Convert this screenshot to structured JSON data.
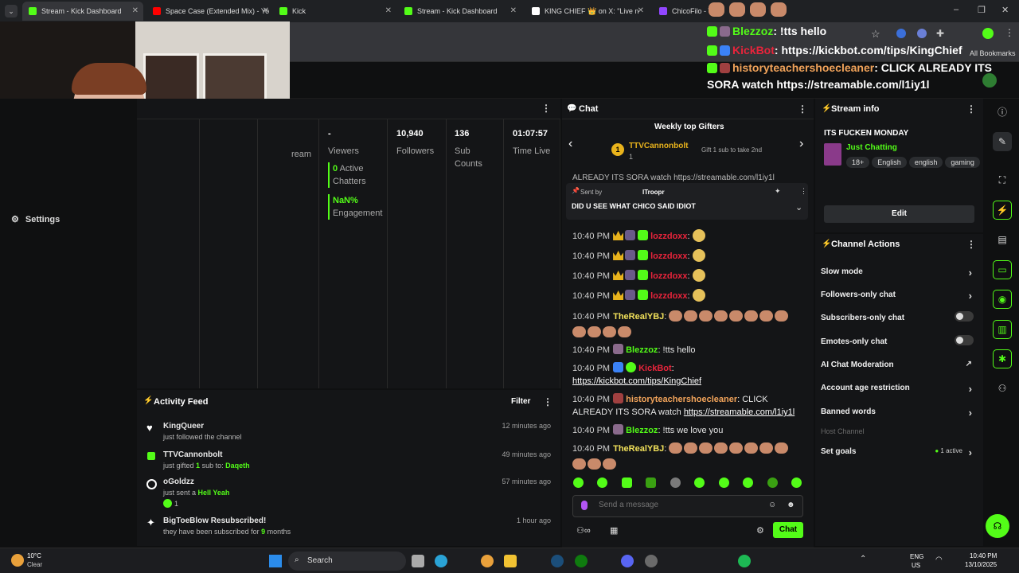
{
  "browser": {
    "tabs": [
      {
        "title": "Stream - Kick Dashboard",
        "color": "#53fc18"
      },
      {
        "title": "Space Case (Extended Mix) - Yo",
        "color": "#ff0000"
      },
      {
        "title": "Kick",
        "color": "#53fc18"
      },
      {
        "title": "Stream - Kick Dashboard",
        "color": "#53fc18"
      },
      {
        "title": "KING CHIEF 👑 on X: \"Live n",
        "color": "#ffffff"
      },
      {
        "title": "ChicoFilo - Twi",
        "color": "#9146ff"
      }
    ],
    "bookmarks_label": "All Bookmarks"
  },
  "overlay_chat": [
    {
      "user": "Blezzoz",
      "user_color": "#53fc18",
      "text": ": !tts hello"
    },
    {
      "user": "KickBot",
      "user_color": "#e8243b",
      "text": ": https://kickbot.com/tips/KingChief"
    },
    {
      "user": "historyteachershoecleaner",
      "user_color": "#f1a35a",
      "text": ": CLICK ALREADY ITS SORA watch https://streamable.com/l1iy1l"
    }
  ],
  "left_nav": {
    "settings_label": "Settings"
  },
  "stats": {
    "stream_label": "ream",
    "viewers_value": "-",
    "viewers_label": "Viewers",
    "active_chatters_value": "0",
    "active_chatters_label": "Active Chatters",
    "engagement_value": "NaN%",
    "engagement_label": "Engagement",
    "followers_value": "10,940",
    "followers_label": "Followers",
    "subs_value": "136",
    "subs_label": "Sub Counts",
    "time_live_value": "01:07:57",
    "time_live_label": "Time Live"
  },
  "activity": {
    "title": "Activity Feed",
    "filter_label": "Filter",
    "items": [
      {
        "name": "KingQueer",
        "sub": "just followed the channel",
        "time": "12 minutes ago"
      },
      {
        "name": "TTVCannonbolt",
        "sub_prefix": "just gifted",
        "sub_count": "1",
        "sub_mid": "sub to:",
        "sub_target": "Daqeth",
        "time": "49 minutes ago"
      },
      {
        "name": "oGoldzz",
        "sub_prefix": "just sent a",
        "sub_target": "Hell Yeah",
        "extra": "1",
        "time": "57 minutes ago"
      },
      {
        "name": "BigToeBlow Resubscribed!",
        "sub_prefix": "they have been subscribed for",
        "sub_count": "9",
        "sub_suffix": "months",
        "time": "1 hour ago"
      }
    ]
  },
  "chat": {
    "title": "Chat",
    "gifters_title": "Weekly top Gifters",
    "gifter_rank": "1",
    "gifter_name": "TTVCannonbolt",
    "gifter_count": "1",
    "gifter_hint": "Gift 1 sub to take 2nd",
    "scroll_preview": "ALREADY ITS SORA watch https://streamable.com/l1iy1l",
    "pinned_sent_by": "Sent by",
    "pinned_user": "ITroopr",
    "pinned_text": "DID U SEE WHAT CHICO SAID IDIOT",
    "messages": [
      {
        "time": "10:40 PM",
        "user": "lozzdoxx",
        "color": "#e8243b",
        "text": ":"
      },
      {
        "time": "10:40 PM",
        "user": "lozzdoxx",
        "color": "#e8243b",
        "text": ":"
      },
      {
        "time": "10:40 PM",
        "user": "lozzdoxx",
        "color": "#e8243b",
        "text": ":"
      },
      {
        "time": "10:40 PM",
        "user": "lozzdoxx",
        "color": "#e8243b",
        "text": ":"
      },
      {
        "time": "10:40 PM",
        "user": "TheRealYBJ",
        "color": "#f1e05a",
        "text": ":"
      },
      {
        "time": "10:40 PM",
        "user": "Blezzoz",
        "color": "#53fc18",
        "text": ": !tts hello"
      },
      {
        "time": "10:40 PM",
        "user": "KickBot",
        "color": "#e8243b",
        "text": ":",
        "link": "https://kickbot.com/tips/KingChief"
      },
      {
        "time": "10:40 PM",
        "user": "historyteachershoecleaner",
        "color": "#f1a35a",
        "text": ": CLICK ALREADY ITS SORA watch",
        "link": "https://streamable.com/l1iy1l"
      },
      {
        "time": "10:40 PM",
        "user": "Blezzoz",
        "color": "#53fc18",
        "text": ": !tts we love you"
      },
      {
        "time": "10:40 PM",
        "user": "TheRealYBJ",
        "color": "#f1e05a",
        "text": ":"
      }
    ],
    "input_placeholder": "Send a message",
    "send_label": "Chat"
  },
  "stream_info": {
    "title": "Stream info",
    "stream_title": "ITS FUCKEN MONDAY",
    "category": "Just Chatting",
    "tags": [
      "18+",
      "English",
      "english",
      "gaming"
    ],
    "edit_label": "Edit"
  },
  "channel_actions": {
    "title": "Channel Actions",
    "items": [
      {
        "label": "Slow mode"
      },
      {
        "label": "Followers-only chat"
      },
      {
        "label": "Subscribers-only chat"
      },
      {
        "label": "Emotes-only chat"
      },
      {
        "label": "AI Chat Moderation"
      },
      {
        "label": "Account age restriction"
      },
      {
        "label": "Banned words"
      },
      {
        "label": "Host Channel"
      },
      {
        "label": "Set goals"
      }
    ],
    "goals_active": "1 active"
  },
  "taskbar": {
    "weather_temp": "10°C",
    "weather_desc": "Clear",
    "search_label": "Search",
    "lang1": "ENG",
    "lang2": "US",
    "time": "10:40 PM",
    "date": "13/10/2025"
  },
  "colors": {
    "accent": "#53fc18",
    "panel": "#141517",
    "bg": "#0f1011"
  }
}
